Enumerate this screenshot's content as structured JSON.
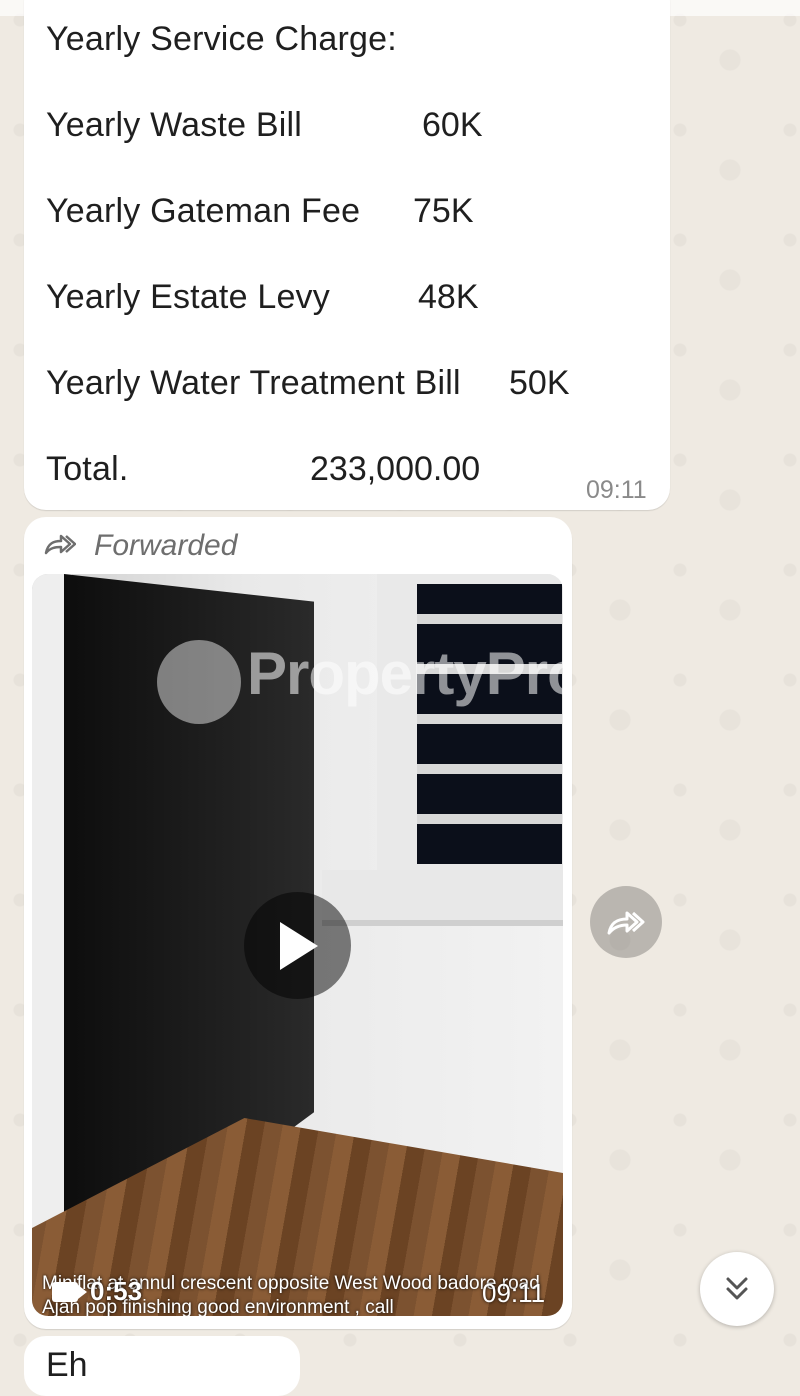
{
  "message_text": {
    "header": "Yearly Service Charge:",
    "rows": [
      {
        "label": "Yearly Waste Bill",
        "amount": "60K"
      },
      {
        "label": "Yearly Gateman Fee",
        "amount": "75K"
      },
      {
        "label": "Yearly Estate Levy",
        "amount": "48K"
      },
      {
        "label": "Yearly Water Treatment Bill",
        "amount": "50K"
      }
    ],
    "total_label": "Total.",
    "total_amount": "233,000.00",
    "time": "09:11"
  },
  "media_message": {
    "forwarded_label": "Forwarded",
    "watermark": "PropertyPro",
    "duration": "0:53",
    "time": "09:11",
    "caption": "Miniflat at annul crescent opposite West Wood badore road Ajah pop finishing good environment , call"
  },
  "next_message_partial": "Eh",
  "colors": {
    "chat_background": "#efeae2",
    "bubble": "#ffffff",
    "timestamp": "#8a8a8a"
  }
}
